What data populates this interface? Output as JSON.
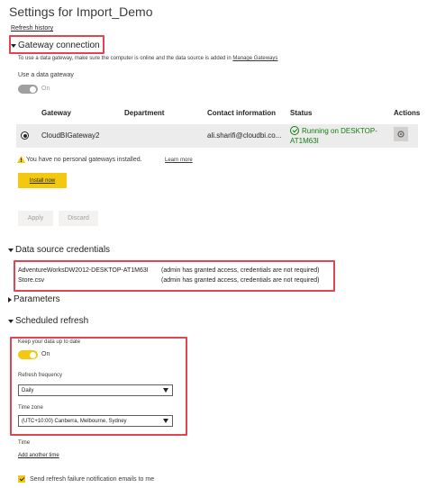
{
  "page": {
    "title": "Settings for Import_Demo",
    "refresh_history": "Refresh history"
  },
  "gateway": {
    "heading": "Gateway connection",
    "description_prefix": "To use a data gateway, make sure the computer is online and the data source is added in ",
    "manage_link": "Manage Gateways",
    "use_gateway_label": "Use a data gateway",
    "toggle_label": "On",
    "columns": {
      "gateway": "Gateway",
      "department": "Department",
      "contact": "Contact information",
      "status": "Status",
      "actions": "Actions"
    },
    "rows": [
      {
        "gateway": "CloudBIGateway2",
        "department": "",
        "contact": "ali.sharifi@cloudbi.co...",
        "status_line1": "Running on DESKTOP-",
        "status_line2": "AT1M63I"
      }
    ],
    "warning_text": "You have no personal gateways installed.",
    "learn_more": "Learn more",
    "install_button": "Install now",
    "apply_button": "Apply",
    "discard_button": "Discard"
  },
  "credentials": {
    "heading": "Data source credentials",
    "items": [
      {
        "name": "AdventureWorksDW2012-DESKTOP-AT1M63I",
        "note": "(admin has granted access, credentials are not required)"
      },
      {
        "name": "Store.csv",
        "note": "(admin has granted access, credentials are not required)"
      }
    ]
  },
  "parameters": {
    "heading": "Parameters"
  },
  "scheduled": {
    "heading": "Scheduled refresh",
    "keep_label": "Keep your data up to date",
    "toggle_label": "On",
    "frequency_label": "Refresh frequency",
    "frequency_value": "Daily",
    "timezone_label": "Time zone",
    "timezone_value": "(UTC+10:00) Canberra, Melbourne, Sydney",
    "time_label": "Time",
    "add_time": "Add another time",
    "notify_label": "Send refresh failure notification emails to me"
  },
  "colors": {
    "accent_yellow": "#f2c811",
    "highlight_red": "#e04552",
    "status_green": "#107c10"
  }
}
